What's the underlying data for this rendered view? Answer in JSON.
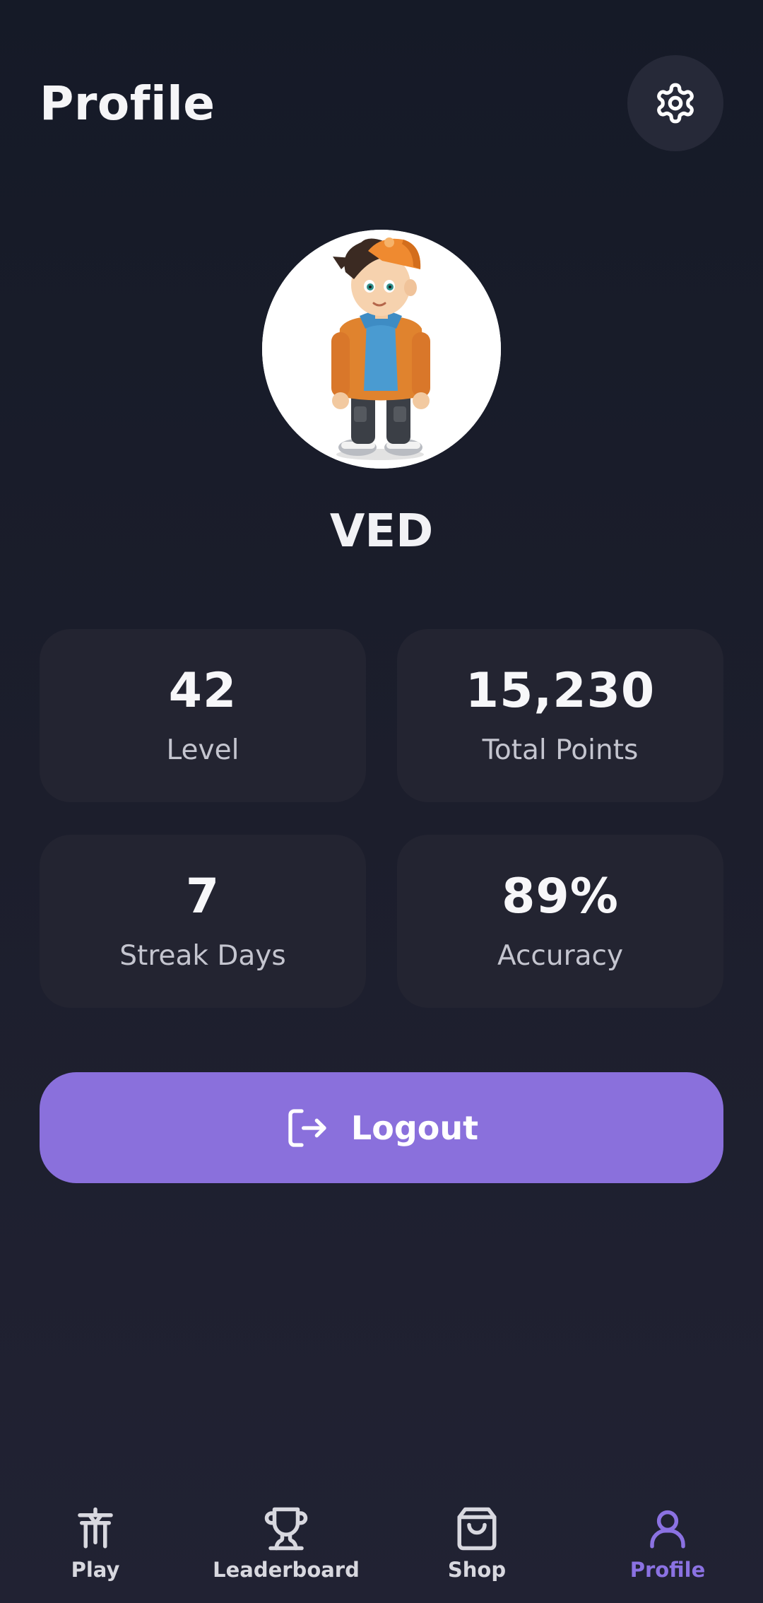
{
  "header": {
    "title": "Profile",
    "settings_icon": "gear-icon"
  },
  "profile": {
    "username": "VED",
    "avatar": "cartoon-boy-avatar"
  },
  "stats": [
    {
      "value": "42",
      "label": "Level"
    },
    {
      "value": "15,230",
      "label": "Total Points"
    },
    {
      "value": "7",
      "label": "Streak Days"
    },
    {
      "value": "89%",
      "label": "Accuracy"
    }
  ],
  "logout": {
    "label": "Logout",
    "icon": "logout-icon"
  },
  "nav": {
    "items": [
      {
        "label": "Play",
        "icon": "play-icon"
      },
      {
        "label": "Leaderboard",
        "icon": "trophy-icon"
      },
      {
        "label": "Shop",
        "icon": "shopping-bag-icon"
      },
      {
        "label": "Profile",
        "icon": "user-icon",
        "active": true
      }
    ]
  },
  "colors": {
    "accent": "#8a70dc",
    "card": "#232431",
    "background": "#181c29"
  }
}
